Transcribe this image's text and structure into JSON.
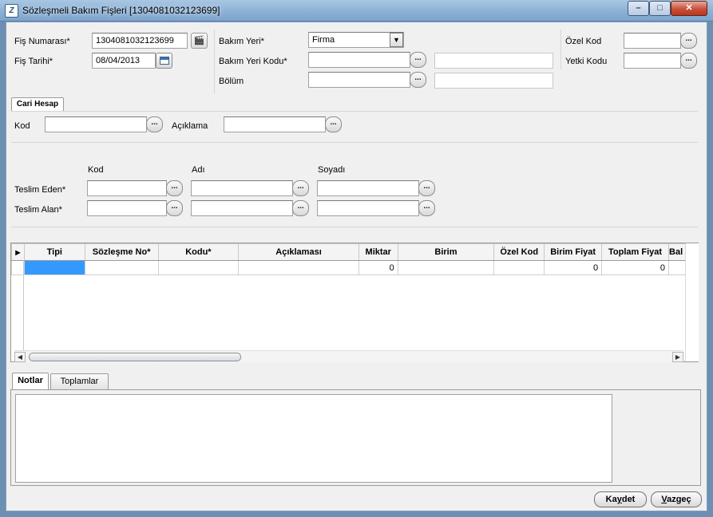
{
  "window": {
    "title": "Sözleşmeli Bakım Fişleri [1304081032123699]",
    "app_icon_text": "Z",
    "minimize_icon": "minimize-icon",
    "maximize_icon": "maximize-icon",
    "close_icon": "close-icon"
  },
  "header": {
    "fis_numarasi_label": "Fiş Numarası*",
    "fis_numarasi_value": "1304081032123699",
    "fis_tarihi_label": "Fiş Tarihi*",
    "fis_tarihi_value": "08/04/2013",
    "bakim_yeri_label": "Bakım Yeri*",
    "bakim_yeri_value": "Firma",
    "bakim_yeri_kodu_label": "Bakım Yeri Kodu*",
    "bolum_label": "Bölüm",
    "ozel_kod_label": "Özel Kod",
    "yetki_kodu_label": "Yetki Kodu",
    "lookup_text": "..."
  },
  "cari": {
    "group_tab": "Cari Hesap",
    "kod_label": "Kod",
    "aciklama_label": "Açıklama"
  },
  "teslim": {
    "col_kod": "Kod",
    "col_adi": "Adı",
    "col_soyadi": "Soyadı",
    "teslim_eden_label": "Teslim Eden*",
    "teslim_alan_label": "Teslim Alan*"
  },
  "grid": {
    "columns": [
      "Tipi",
      "Sözleşme No*",
      "Kodu*",
      "Açıklaması",
      "Miktar",
      "Birim",
      "Özel Kod",
      "Birim Fiyat",
      "Toplam Fiyat",
      "Bal"
    ],
    "row": {
      "miktar": "0",
      "birim_fiyat": "0",
      "toplam_fiyat": "0"
    }
  },
  "tabs": {
    "notlar": "Notlar",
    "toplamlar": "Toplamlar"
  },
  "footer": {
    "kaydet_pre": "Ka",
    "kaydet_u": "y",
    "kaydet_post": "det",
    "vazgec_u": "V",
    "vazgec_post": "azgeç"
  },
  "colors": {
    "selected_cell": "#3399ff",
    "title_bar": "#8aafd4",
    "close_button": "#c9503a"
  }
}
